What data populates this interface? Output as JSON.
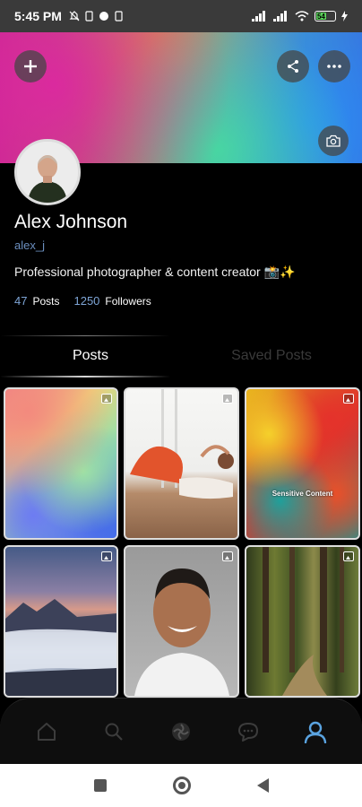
{
  "status_bar": {
    "time": "5:45 PM",
    "battery": "54"
  },
  "profile": {
    "name": "Alex Johnson",
    "handle": "alex_j",
    "bio": "Professional photographer & content creator 📸✨",
    "posts_count": "47",
    "posts_label": "Posts",
    "followers_count": "1250",
    "followers_label": "Followers"
  },
  "tabs": [
    {
      "label": "Posts",
      "active": true
    },
    {
      "label": "Saved Posts",
      "active": false
    }
  ],
  "grid": {
    "sensitive_label": "Sensitive Content",
    "items": [
      {
        "kind": "gradient"
      },
      {
        "kind": "workout"
      },
      {
        "kind": "abstract"
      },
      {
        "kind": "mountain"
      },
      {
        "kind": "portrait"
      },
      {
        "kind": "forest"
      }
    ]
  },
  "icons": {
    "add": "plus-icon",
    "share": "share-icon",
    "more": "more-icon",
    "camera": "camera-icon",
    "nav": [
      "home-icon",
      "search-icon",
      "explore-icon",
      "chat-icon",
      "profile-icon"
    ]
  },
  "colors": {
    "accent": "#5aa3e0",
    "handle": "#6b8fbf"
  }
}
